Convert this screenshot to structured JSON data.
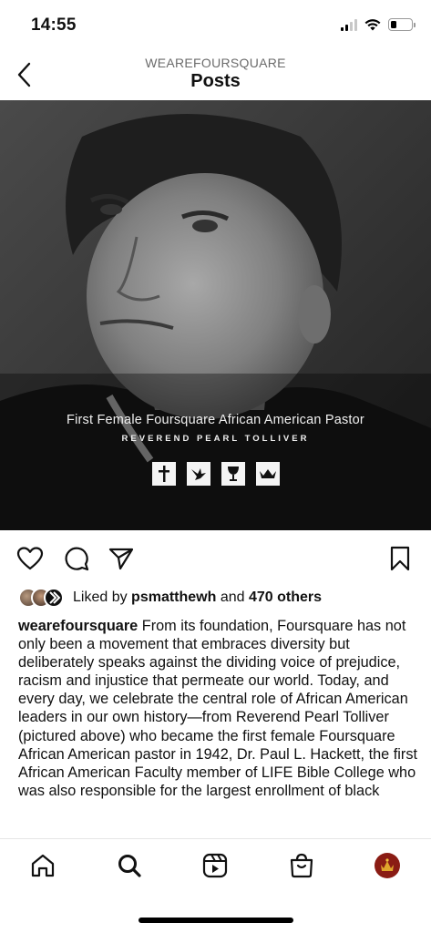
{
  "status_bar": {
    "time": "14:55",
    "battery_level": 0.28
  },
  "header": {
    "account": "WEAREFOURSQUARE",
    "title": "Posts"
  },
  "post": {
    "image_caption": "First Female Foursquare African American Pastor",
    "image_subcaption": "REVEREND PEARL TOLLIVER",
    "emblems": [
      "cross-icon",
      "dove-icon",
      "cup-icon",
      "crown-icon"
    ]
  },
  "likes": {
    "prefix": "Liked by",
    "user": "psmatthewh",
    "joiner": "and",
    "others": "470 others"
  },
  "caption": {
    "username": "wearefoursquare",
    "text": "From its foundation, Foursquare has not only been a movement that embraces diversity but deliberately speaks against the dividing voice of prejudice, racism and injustice that permeate our world. Today, and every day, we celebrate the central role of African American leaders in our own history—from Reverend Pearl Tolliver (pictured above) who became the first female Foursquare African American pastor in 1942, Dr. Paul L. Hackett, the first African American Faculty member of LIFE Bible College who was also responsible for the largest enrollment of black"
  },
  "tabs": [
    "home-icon",
    "search-icon",
    "reels-icon",
    "shop-icon",
    "profile-avatar"
  ],
  "colors": {
    "text": "#111111",
    "muted": "#6b6b6b",
    "photo_dark": "#1d1d1d"
  }
}
